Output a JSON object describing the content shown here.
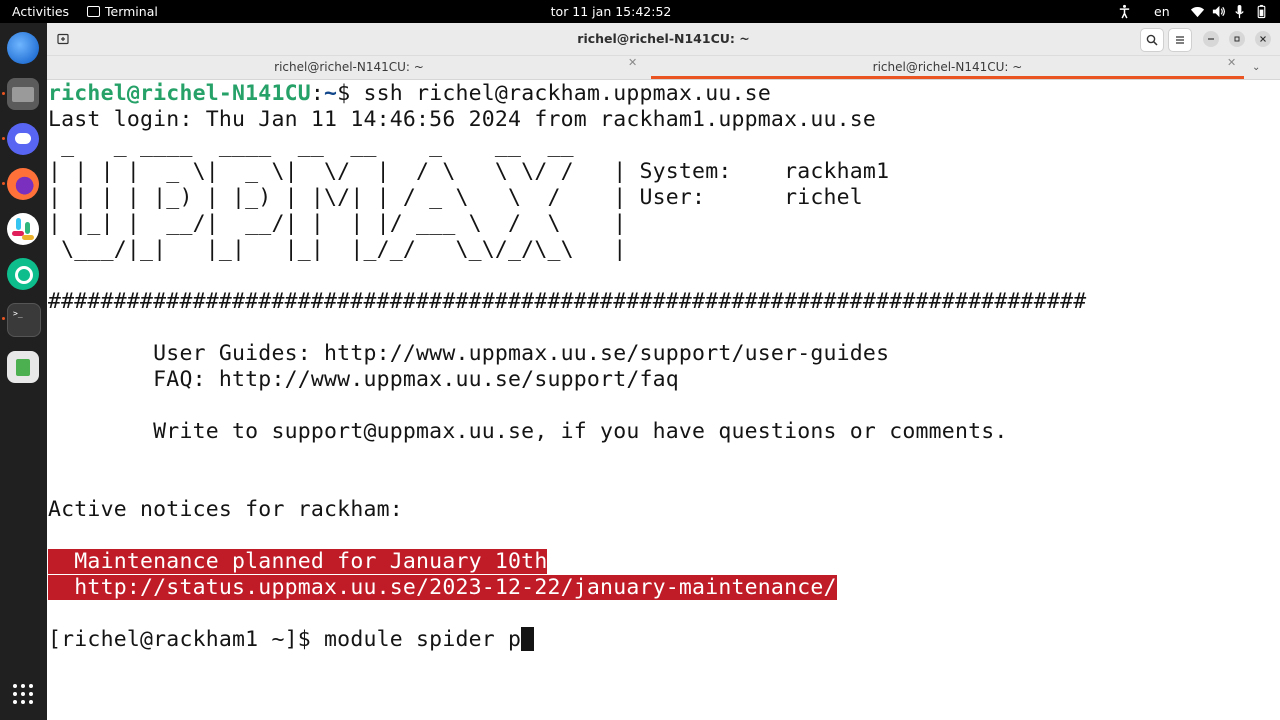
{
  "topbar": {
    "activities": "Activities",
    "app_name": "Terminal",
    "clock": "tor 11 jan  15:42:52",
    "language": "en"
  },
  "dock": {
    "apps": [
      "thunderbird",
      "files",
      "discord",
      "firefox",
      "slack",
      "element",
      "terminal",
      "trash",
      "show-apps"
    ]
  },
  "window": {
    "title": "richel@richel-N141CU: ~",
    "tabs": [
      {
        "label": "richel@richel-N141CU: ~",
        "active": false
      },
      {
        "label": "richel@richel-N141CU: ~",
        "active": true
      }
    ]
  },
  "terminal": {
    "prompt_user": "richel@richel-N141CU",
    "prompt_sep": ":",
    "prompt_path": "~",
    "prompt_cmd": "$ ssh richel@rackham.uppmax.uu.se",
    "last_login": "Last login: Thu Jan 11 14:46:56 2024 from rackham1.uppmax.uu.se",
    "banner": [
      " _   _ ____  ____  __  __    _    __  __",
      "| | | |  _ \\|  _ \\|  \\/  |  / \\   \\ \\/ /   | System:    rackham1",
      "| | | | |_) | |_) | |\\/| | / _ \\   \\  /    | User:      richel",
      "| |_| |  __/|  __/| |  | |/ ___ \\  /  \\    |",
      " \\___/|_|   |_|   |_|  |_/_/   \\_\\/_/\\_\\   |"
    ],
    "hashes": "###############################################################################",
    "user_guides": "        User Guides: http://www.uppmax.uu.se/support/user-guides",
    "faq": "        FAQ: http://www.uppmax.uu.se/support/faq",
    "write_to": "        Write to support@uppmax.uu.se, if you have questions or comments.",
    "notices_heading": "Active notices for rackham:",
    "notice_lines": [
      "  Maintenance planned for January 10th",
      "  http://status.uppmax.uu.se/2023-12-22/january-maintenance/"
    ],
    "current_prompt": "[richel@rackham1 ~]$ module spider p"
  },
  "colors": {
    "prompt_user": "#26a269",
    "prompt_path": "#12488b",
    "notice_bg": "#c01c28",
    "accent": "#e95420"
  }
}
